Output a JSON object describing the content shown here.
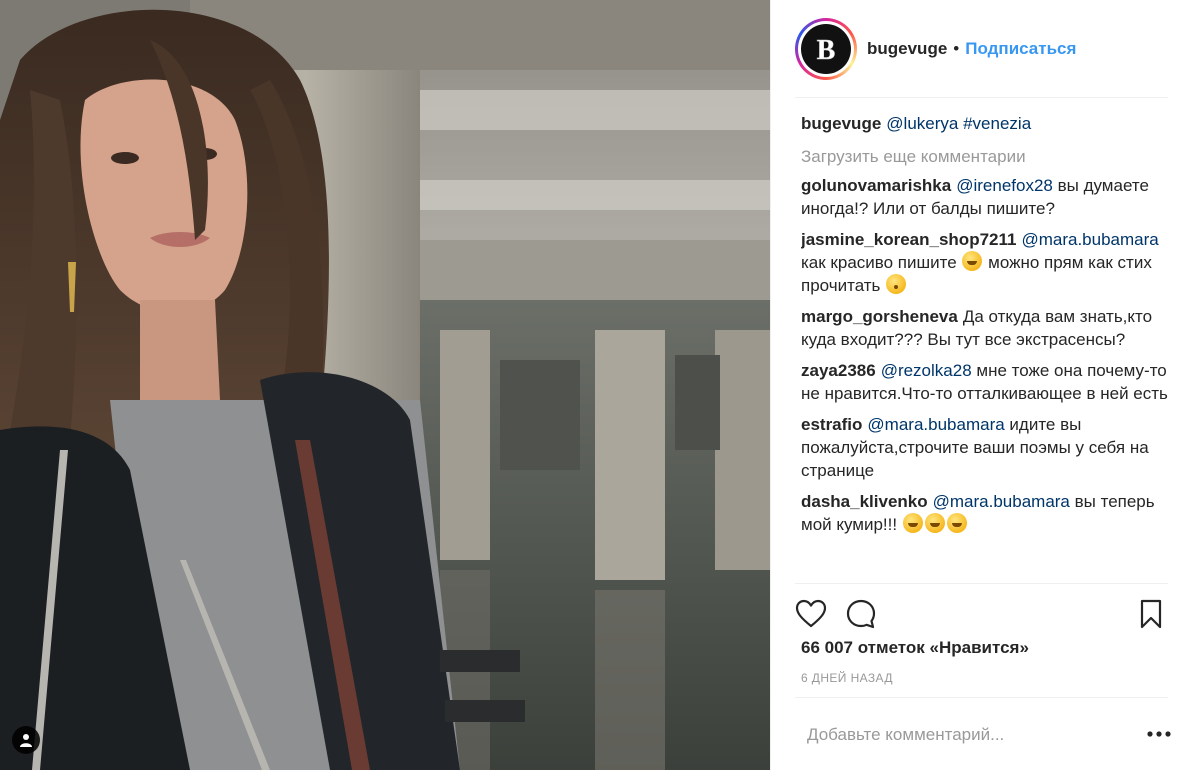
{
  "header": {
    "username": "bugevuge",
    "separator": "•",
    "follow_label": "Подписаться"
  },
  "caption": {
    "username": "bugevuge",
    "mention": "@lukerya",
    "hashtag": "#venezia"
  },
  "load_more_label": "Загрузить еще комментарии",
  "comments": [
    {
      "user": "golunovamarishka",
      "mention": "@irenefox28",
      "text": "вы думаете иногда!? Или от балды пишите?"
    },
    {
      "user": "jasmine_korean_shop7211",
      "mention": "@mara.bubamara",
      "text_before_emoji": "как красиво пишите",
      "text_after_emoji": "можно прям как стих прочитать"
    },
    {
      "user": "margo_gorsheneva",
      "text": "Да откуда вам знать,кто куда входит??? Вы тут все экстрасенсы?"
    },
    {
      "user": "zaya2386",
      "mention": "@rezolka28",
      "text": "мне тоже она почему-то не нравится.Что-то отталкивающее в ней есть"
    },
    {
      "user": "estrafio",
      "mention": "@mara.bubamara",
      "text": "идите вы пожалуйста,строчите ваши поэмы у себя на странице"
    },
    {
      "user": "dasha_klivenko",
      "mention": "@mara.bubamara",
      "text": "вы теперь мой кумир!!!"
    }
  ],
  "likes_text": "66 007 отметок «Нравится»",
  "timestamp": "6 ДНЕЙ НАЗАД",
  "add_comment_placeholder": "Добавьте комментарий...",
  "avatar_letter": "B",
  "icons": [
    "heart-icon",
    "comment-icon",
    "bookmark-icon",
    "more-options-icon",
    "user-tag-icon"
  ],
  "colors": {
    "link": "#3897f0",
    "mention": "#003569",
    "muted": "#999999",
    "text": "#262626"
  }
}
